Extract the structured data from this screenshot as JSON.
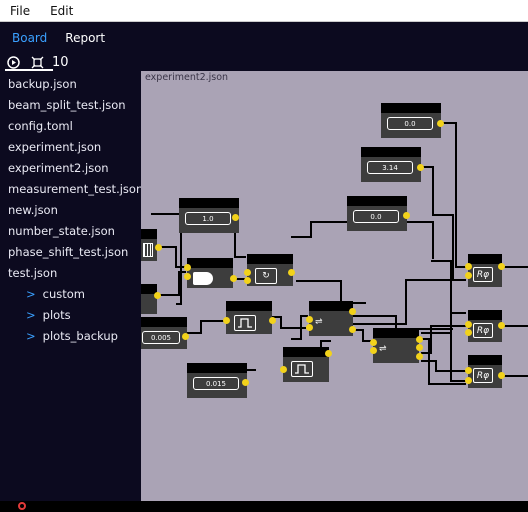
{
  "menu": {
    "file": "File",
    "edit": "Edit"
  },
  "tabs": [
    {
      "label": "Board",
      "active": true
    },
    {
      "label": "Report",
      "active": false
    }
  ],
  "toolbar": {
    "count": "10"
  },
  "sidebar": {
    "files": [
      "backup.json",
      "beam_split_test.json",
      "config.toml",
      "experiment.json",
      "experiment2.json",
      "measurement_test.json",
      "new.json",
      "number_state.json",
      "phase_shift_test.json",
      "test.json"
    ],
    "folders": [
      "custom",
      "plots",
      "plots_backup"
    ]
  },
  "canvas": {
    "title": "experiment2.json",
    "values": {
      "v1": "1.0",
      "v2": "0.0",
      "v3": "3.14",
      "v4": "0.0",
      "v5": "0.005",
      "v6": "0.015"
    }
  },
  "colors": {
    "accent": "#3aa0ff",
    "port": "#f2d21b",
    "canvas": "#aaa3b5",
    "panel": "#0c0a1f"
  }
}
